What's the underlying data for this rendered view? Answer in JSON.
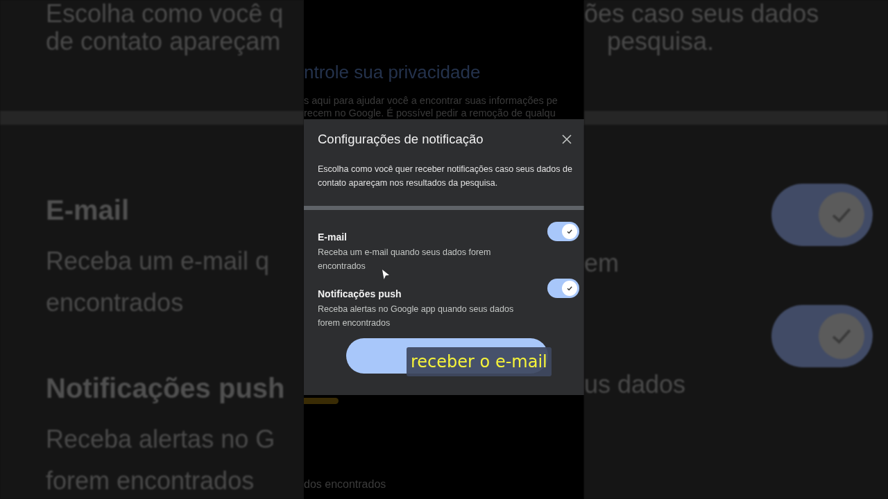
{
  "backdrop_left": [
    {
      "lines": [
        "Escolha como você q",
        "de contato apareçam"
      ]
    },
    {
      "heading": "E-mail",
      "lines": [
        "Receba um e-mail q",
        "encontrados"
      ]
    },
    {
      "heading": "Notificações push",
      "lines": [
        "Receba alertas no G",
        "forem encontrados"
      ]
    }
  ],
  "backdrop_right": [
    {
      "lines": [
        "ões caso seus dados",
        "pesquisa."
      ]
    },
    {
      "on": true,
      "lines": [
        "em"
      ]
    },
    {
      "on": true,
      "lines": [
        "us dados"
      ]
    }
  ],
  "page_behind": {
    "heading": "ntrole sua privacidade",
    "lines": [
      "s aqui para ajudar você a encontrar suas informações pe",
      "recem no Google. É possível pedir a remoção de qualqu"
    ],
    "footer": "dos encontrados"
  },
  "dialog": {
    "title": "Configurações de notificação",
    "description": "Escolha como você quer receber notificações caso seus dados de contato apareçam nos resultados da pesquisa.",
    "options": [
      {
        "title": "E-mail",
        "description": "Receba um e-mail quando seus dados forem encontrados",
        "on": true
      },
      {
        "title": "Notificações push",
        "description": "Receba alertas no Google app quando seus dados forem encontrados",
        "on": true
      }
    ]
  },
  "caption": "receber o e-mail"
}
